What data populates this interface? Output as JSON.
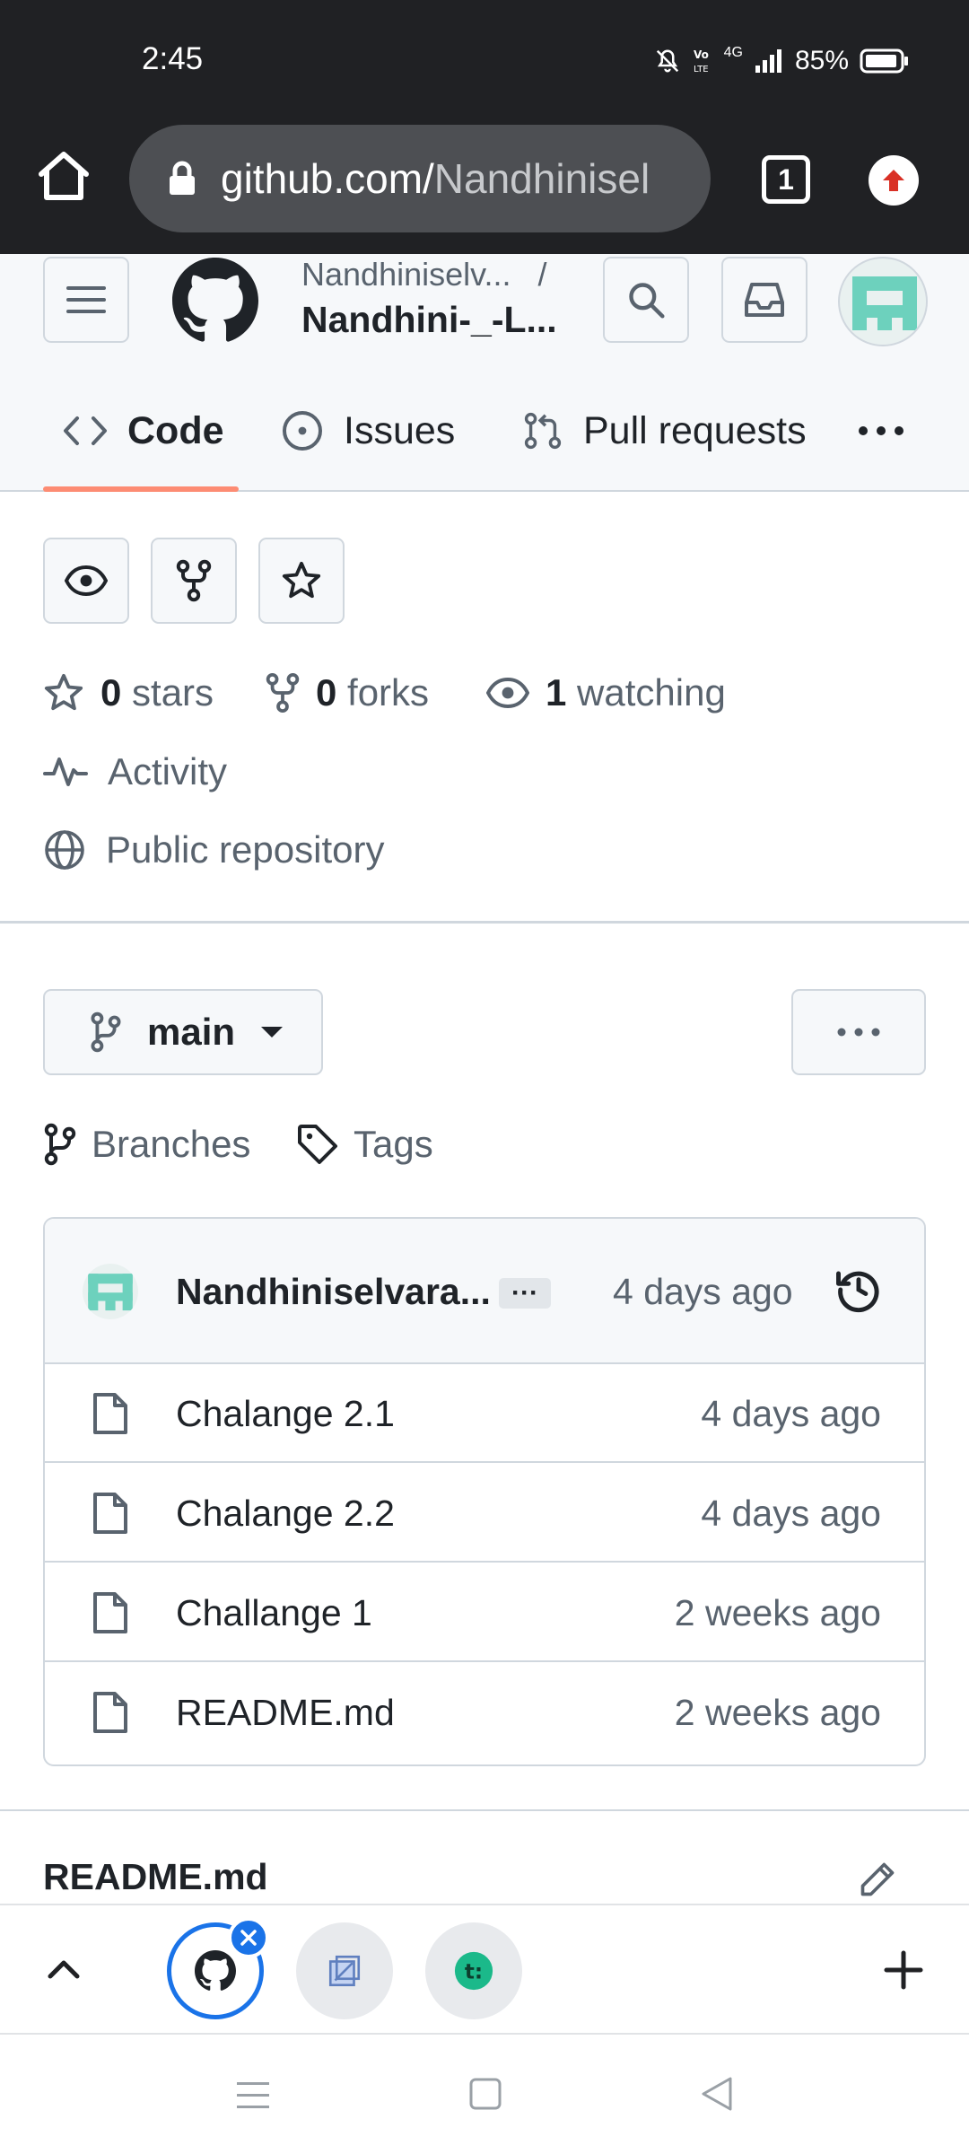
{
  "status_bar": {
    "time": "2:45",
    "network": "4G",
    "battery": "85%"
  },
  "browser": {
    "url_host": "github.com/",
    "url_rest": "Nandhinisel",
    "tab_count": "1"
  },
  "header": {
    "owner": "Nandhiniselv...",
    "separator": "/",
    "repo": "Nandhini-_-L..."
  },
  "nav_tabs": [
    {
      "label": "Code",
      "selected": true
    },
    {
      "label": "Issues"
    },
    {
      "label": "Pull requests"
    }
  ],
  "stats": {
    "stars_count": "0",
    "stars_label": "stars",
    "forks_count": "0",
    "forks_label": "forks",
    "watching_count": "1",
    "watching_label": "watching",
    "activity": "Activity",
    "visibility": "Public repository"
  },
  "branch": {
    "name": "main",
    "branches_link": "Branches",
    "tags_link": "Tags"
  },
  "latest_commit": {
    "author": "Nandhiniselvara...",
    "ellipsis": "···",
    "time": "4 days ago"
  },
  "files": [
    {
      "name": "Chalange 2.1",
      "time": "4 days ago"
    },
    {
      "name": "Chalange 2.2",
      "time": "4 days ago"
    },
    {
      "name": "Challange 1",
      "time": "2 weeks ago"
    },
    {
      "name": "README.md",
      "time": "2 weeks ago"
    }
  ],
  "readme": {
    "title": "README.md"
  },
  "colors": {
    "chrome_bg": "#202124",
    "tab_underline": "#fd8c73",
    "active_tab_ring": "#1a73e8",
    "avatar_green": "#6dd1bd"
  },
  "icons": {
    "home": "home-icon",
    "lock": "lock-icon",
    "ext": "arrow-up-icon",
    "menu": "hamburger-icon",
    "logo": "github-icon",
    "search": "search-icon",
    "inbox": "inbox-icon",
    "code": "code-icon",
    "issue": "issue-opened-icon",
    "pull": "git-pull-request-icon",
    "kebab": "kebab-horizontal-icon",
    "eye": "eye-icon",
    "fork": "repo-forked-icon",
    "star": "star-icon",
    "pulse": "pulse-icon",
    "globe": "globe-icon",
    "branch": "git-branch-icon",
    "tag": "tag-icon",
    "history": "history-icon",
    "file": "file-icon",
    "pencil": "pencil-icon"
  }
}
